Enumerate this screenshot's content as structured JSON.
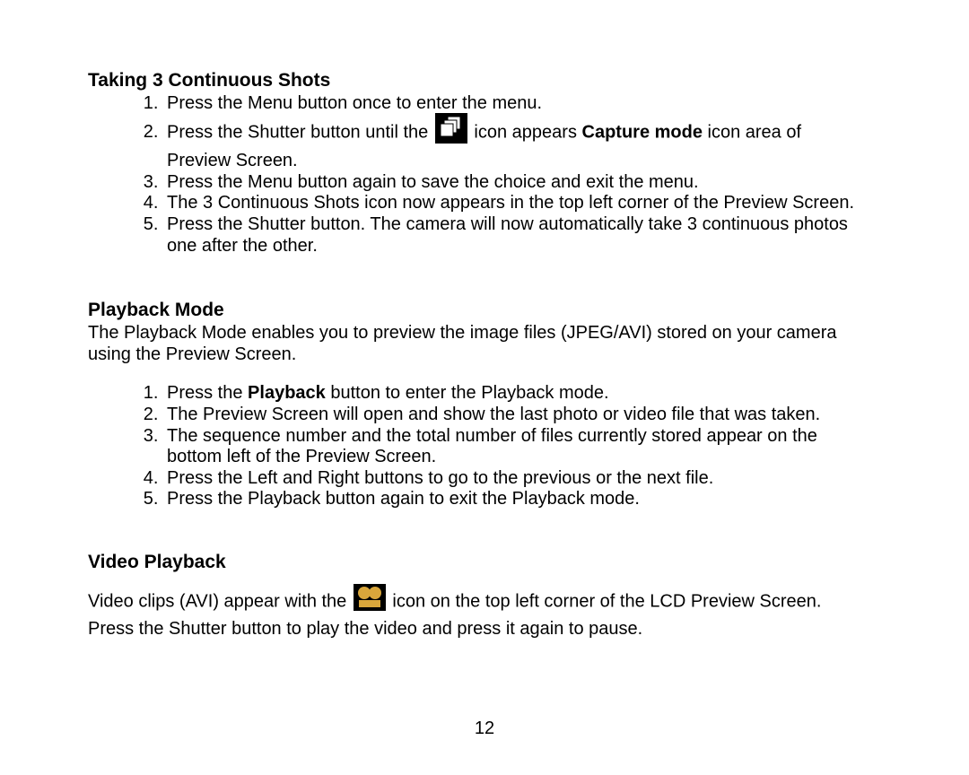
{
  "section1": {
    "heading": "Taking 3 Continuous Shots",
    "item1": "Press the Menu button once to enter the menu.",
    "item2_pre": "Press the Shutter button until the ",
    "item2_post_a": " icon appears ",
    "item2_bold": "Capture mode",
    "item2_post_b": " icon area of Preview Screen.",
    "item3": "Press the Menu button again to save the choice and exit the menu.",
    "item4": "The 3 Continuous Shots icon now appears in the top left corner of the Preview Screen.",
    "item5": "Press the Shutter button. The camera will now automatically take 3 continuous photos one after the other."
  },
  "section2": {
    "heading": "Playback Mode",
    "intro": "The Playback Mode enables you to preview the image files (JPEG/AVI) stored on your camera  using the Preview Screen.",
    "item1_pre": "Press the ",
    "item1_bold": "Playback",
    "item1_post": " button to enter the Playback mode.",
    "item2": "The Preview Screen will open and show the last photo or video file that was taken.",
    "item3": "The sequence number and the total number of files currently stored appear on the bottom left of the Preview Screen.",
    "item4": "Press the Left and Right buttons to go to the previous or the next file.",
    "item5": "Press the Playback button again to exit the Playback mode."
  },
  "section3": {
    "heading": "Video Playback",
    "line1_pre": "Video clips (AVI) appear with the ",
    "line1_post": " icon on the top left corner of the LCD Preview Screen.",
    "line2": "Press the Shutter button to play the video and press it again to pause."
  },
  "pageNumber": "12"
}
